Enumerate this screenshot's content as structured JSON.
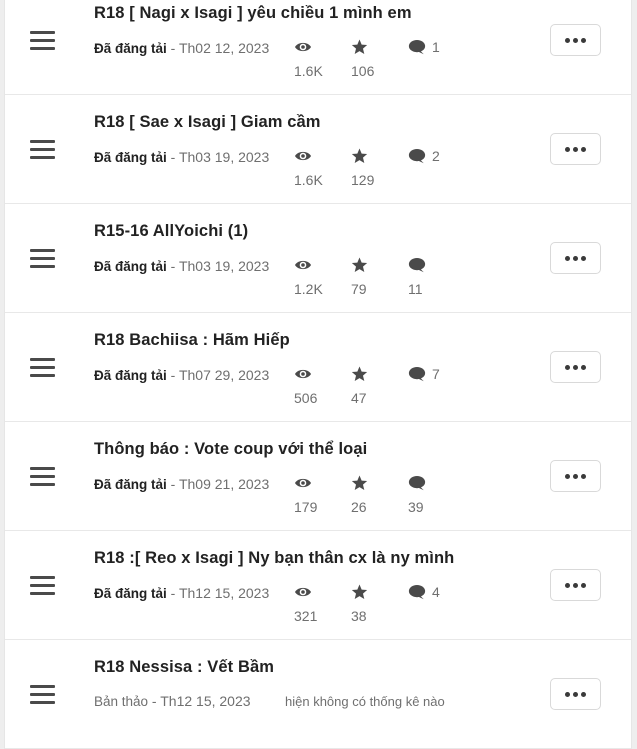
{
  "stories": [
    {
      "title": "R18 [ Nagi x Isagi ] yêu chiều 1 mình em",
      "status": "Đã đăng tải",
      "date": " - Th02 12, 2023",
      "views": "1.6K",
      "stars": "106",
      "comments_inline": "1",
      "comments": ""
    },
    {
      "title": "R18 [ Sae x Isagi ] Giam cầm",
      "status": "Đã đăng tải",
      "date": " - Th03 19, 2023",
      "views": "1.6K",
      "stars": "129",
      "comments_inline": "2",
      "comments": ""
    },
    {
      "title": "R15-16 AllYoichi (1)",
      "status": "Đã đăng tải",
      "date": " - Th03 19, 2023",
      "views": "1.2K",
      "stars": "79",
      "comments_inline": "",
      "comments": "11"
    },
    {
      "title": "R18 Bachiisa : Hãm Hiếp",
      "status": "Đã đăng tải",
      "date": " - Th07 29, 2023",
      "views": "506",
      "stars": "47",
      "comments_inline": "7",
      "comments": ""
    },
    {
      "title": "Thông báo : Vote coup với thể loại",
      "status": "Đã đăng tải",
      "date": " - Th09 21, 2023",
      "views": "179",
      "stars": "26",
      "comments_inline": "",
      "comments": "39"
    },
    {
      "title": "R18 :[ Reo x Isagi ] Ny bạn thân cx là ny mình",
      "status": "Đã đăng tải",
      "date": " - Th12 15, 2023",
      "views": "321",
      "stars": "38",
      "comments_inline": "4",
      "comments": ""
    }
  ],
  "draft": {
    "title": "R18 Nessisa : Vết Bầm",
    "status": "Bản thảo",
    "date": " - Th12 15, 2023",
    "no_stats": "hiện không có thống kê nào"
  },
  "icons": {
    "drag": "drag-handle-icon",
    "views": "eye-icon",
    "stars": "star-icon",
    "comments": "comment-icon",
    "more": "ellipsis-icon"
  },
  "colors": {
    "text": "#222222",
    "muted": "#6f6f6f",
    "icon": "#4a4a4a"
  }
}
